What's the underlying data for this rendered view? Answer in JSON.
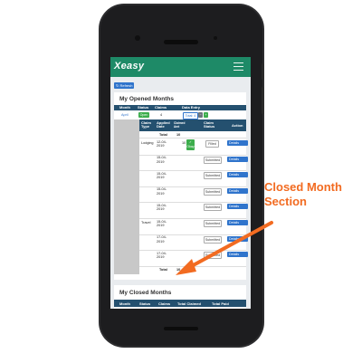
{
  "app": {
    "brand": "Xeasy"
  },
  "toolbar": {
    "refresh_label": "↻ Refresh"
  },
  "opened": {
    "title": "My Opened Months",
    "headers": [
      "Month",
      "Status",
      "Claims",
      "Data Entry"
    ],
    "month": "April",
    "status": "Open",
    "claims": "4",
    "total_label": "Total: 4",
    "sub_headers": [
      "Claim Type",
      "Applied Date",
      "Claimed Amt",
      "Claim Status",
      "Action"
    ],
    "total_row": {
      "label": "Total",
      "value": "10"
    },
    "rows": [
      {
        "type": "Lodging",
        "date": "12-04-2019",
        "amount": "10",
        "status": "Filled",
        "action": "Details",
        "ok_label": "✓ Okay"
      },
      {
        "type": "",
        "date": "15-04-2019",
        "amount": "",
        "status": "Submitted",
        "action": "Details"
      },
      {
        "type": "",
        "date": "15-04-2019",
        "amount": "",
        "status": "Submitted",
        "action": "Details"
      },
      {
        "type": "",
        "date": "15-04-2019",
        "amount": "",
        "status": "Submitted",
        "action": "Details"
      },
      {
        "type": "",
        "date": "15-04-2019",
        "amount": "",
        "status": "Submitted",
        "action": "Details"
      },
      {
        "type": "Travel",
        "date": "15-04-2019",
        "amount": "",
        "status": "Submitted",
        "action": "Details"
      },
      {
        "type": "",
        "date": "17-04-2019",
        "amount": "",
        "status": "Submitted",
        "action": "Details"
      },
      {
        "type": "",
        "date": "17-04-2019",
        "amount": "",
        "status": "Submitted",
        "action": "Details"
      }
    ],
    "footer": {
      "label": "Total",
      "value": "10"
    }
  },
  "closed": {
    "title": "My Closed Months",
    "headers": [
      "Month",
      "Status",
      "Claims",
      "Total Claimed",
      "Total Paid"
    ]
  },
  "annotation": {
    "line1": "Closed Month",
    "line2": "Section"
  },
  "colors": {
    "navbar": "#1e8a67",
    "table_header": "#24506f",
    "accent": "#f26b21",
    "button_blue": "#2f74cc",
    "status_green": "#3cad4c"
  }
}
